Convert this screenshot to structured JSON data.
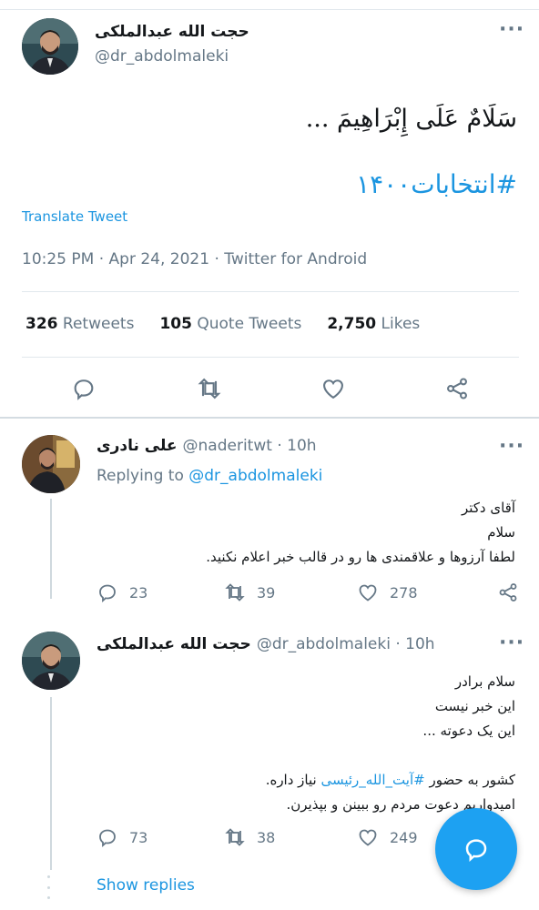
{
  "tweet": {
    "author_name": "حجت الله عبدالملکی",
    "author_handle": "@dr_abdolmaleki",
    "text": "سَلَامٌ عَلَى إِبْرَاهِيمَ ...",
    "hashtag": "#انتخابات۱۴۰۰",
    "translate": "Translate Tweet",
    "timestamp": "10:25 PM · Apr 24, 2021 · Twitter for Android",
    "retweets_count": "326",
    "retweets_label": "Retweets",
    "quotes_count": "105",
    "quotes_label": "Quote Tweets",
    "likes_count": "2,750",
    "likes_label": "Likes"
  },
  "replies": [
    {
      "name": "علی نادری",
      "handle_time": "@naderitwt · 10h",
      "replying_prefix": "Replying to",
      "replying_to": "@dr_abdolmaleki",
      "lines": [
        "آقای دکتر",
        "سلام",
        "لطفا آرزوها و علاقمندی ها رو در قالب خبر اعلام نکنید."
      ],
      "replies": "23",
      "retweets": "39",
      "likes": "278"
    },
    {
      "name": "حجت الله عبدالملکی",
      "handle_time": "@dr_abdolmaleki · 10h",
      "lines": [
        "سلام برادر",
        "این خبر نیست",
        "این یک دعوته ..."
      ],
      "line4_before": "کشور به حضور ",
      "line4_hashtag": "#آیت_الله_رئیسی",
      "line4_after": " نیاز داره.",
      "line5": "امیدواریم دعوت مردم رو ببینن و بپذیرن.",
      "replies": "73",
      "retweets": "38",
      "likes": "249"
    }
  ],
  "show_replies": "Show replies",
  "more_glyph": "···",
  "colors": {
    "accent": "#1da1f2",
    "link": "#1b95e0",
    "muted": "#657786"
  }
}
